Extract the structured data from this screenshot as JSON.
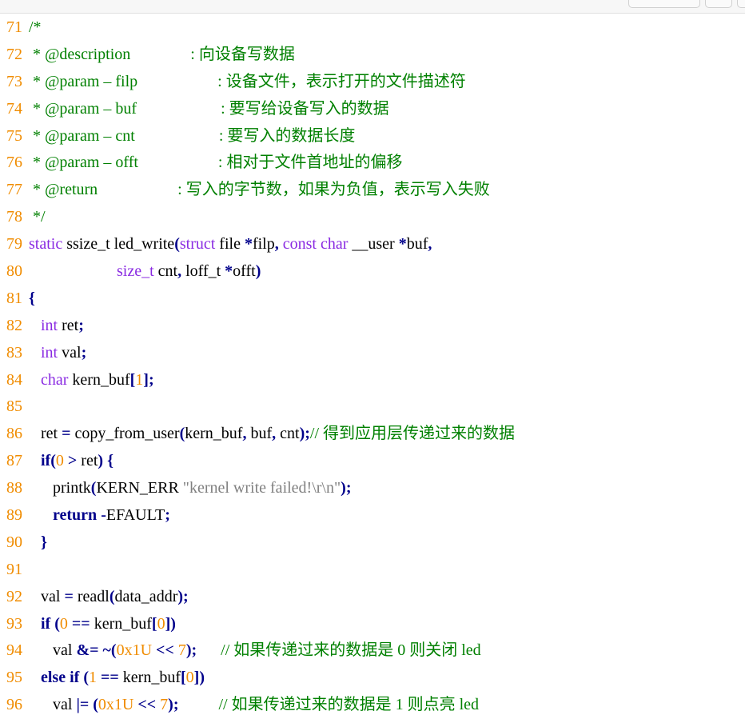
{
  "lines": [
    {
      "no": "71",
      "segs": [
        {
          "t": "/*",
          "c": "c"
        }
      ]
    },
    {
      "no": "72",
      "segs": [
        {
          "t": " * @description               ",
          "c": "c"
        },
        {
          "t": ": 向设备写数据",
          "c": "c"
        }
      ]
    },
    {
      "no": "73",
      "segs": [
        {
          "t": " * @param – filp                    ",
          "c": "c"
        },
        {
          "t": ": 设备文件，表示打开的文件描述符",
          "c": "c"
        }
      ]
    },
    {
      "no": "74",
      "segs": [
        {
          "t": " * @param – buf                     ",
          "c": "c"
        },
        {
          "t": ": 要写给设备写入的数据",
          "c": "c"
        }
      ]
    },
    {
      "no": "75",
      "segs": [
        {
          "t": " * @param – cnt                     ",
          "c": "c"
        },
        {
          "t": ": 要写入的数据长度",
          "c": "c"
        }
      ]
    },
    {
      "no": "76",
      "segs": [
        {
          "t": " * @param – offt                    ",
          "c": "c"
        },
        {
          "t": ": 相对于文件首地址的偏移",
          "c": "c"
        }
      ]
    },
    {
      "no": "77",
      "segs": [
        {
          "t": " * @return                    ",
          "c": "c"
        },
        {
          "t": ": 写入的字节数，如果为负值，表示写入失败",
          "c": "c"
        }
      ]
    },
    {
      "no": "78",
      "segs": [
        {
          "t": " */",
          "c": "c"
        }
      ]
    },
    {
      "no": "79",
      "segs": [
        {
          "t": "static",
          "c": "k"
        },
        {
          "t": " ssize_t led_write",
          "c": ""
        },
        {
          "t": "(",
          "c": "p"
        },
        {
          "t": "struct",
          "c": "k"
        },
        {
          "t": " file ",
          "c": ""
        },
        {
          "t": "*",
          "c": "p"
        },
        {
          "t": "filp",
          "c": ""
        },
        {
          "t": ",",
          "c": "p"
        },
        {
          "t": " const",
          "c": "k"
        },
        {
          "t": " ",
          "c": ""
        },
        {
          "t": "char",
          "c": "k"
        },
        {
          "t": " __user ",
          "c": ""
        },
        {
          "t": "*",
          "c": "p"
        },
        {
          "t": "buf",
          "c": ""
        },
        {
          "t": ",",
          "c": "p"
        }
      ]
    },
    {
      "no": "80",
      "segs": [
        {
          "t": "                      ",
          "c": ""
        },
        {
          "t": "size_t",
          "c": "k"
        },
        {
          "t": " cnt",
          "c": ""
        },
        {
          "t": ",",
          "c": "p"
        },
        {
          "t": " loff_t ",
          "c": ""
        },
        {
          "t": "*",
          "c": "p"
        },
        {
          "t": "offt",
          "c": ""
        },
        {
          "t": ")",
          "c": "p"
        }
      ]
    },
    {
      "no": "81",
      "segs": [
        {
          "t": "{",
          "c": "p"
        }
      ]
    },
    {
      "no": "82",
      "segs": [
        {
          "t": "   ",
          "c": ""
        },
        {
          "t": "int",
          "c": "k"
        },
        {
          "t": " ret",
          "c": ""
        },
        {
          "t": ";",
          "c": "p"
        }
      ]
    },
    {
      "no": "83",
      "segs": [
        {
          "t": "   ",
          "c": ""
        },
        {
          "t": "int",
          "c": "k"
        },
        {
          "t": " val",
          "c": ""
        },
        {
          "t": ";",
          "c": "p"
        }
      ]
    },
    {
      "no": "84",
      "segs": [
        {
          "t": "   ",
          "c": ""
        },
        {
          "t": "char",
          "c": "k"
        },
        {
          "t": " kern_buf",
          "c": ""
        },
        {
          "t": "[",
          "c": "p"
        },
        {
          "t": "1",
          "c": "n"
        },
        {
          "t": "];",
          "c": "p"
        }
      ]
    },
    {
      "no": "85",
      "segs": []
    },
    {
      "no": "86",
      "segs": [
        {
          "t": "   ret ",
          "c": ""
        },
        {
          "t": "=",
          "c": "p"
        },
        {
          "t": " copy_from_user",
          "c": ""
        },
        {
          "t": "(",
          "c": "p"
        },
        {
          "t": "kern_buf",
          "c": ""
        },
        {
          "t": ",",
          "c": "p"
        },
        {
          "t": " buf",
          "c": ""
        },
        {
          "t": ",",
          "c": "p"
        },
        {
          "t": " cnt",
          "c": ""
        },
        {
          "t": ");",
          "c": "p"
        },
        {
          "t": "// 得到应用层传递过来的数据",
          "c": "c"
        }
      ]
    },
    {
      "no": "87",
      "segs": [
        {
          "t": "   ",
          "c": ""
        },
        {
          "t": "if",
          "c": "kb"
        },
        {
          "t": "(",
          "c": "p"
        },
        {
          "t": "0",
          "c": "n"
        },
        {
          "t": " > ",
          "c": "p"
        },
        {
          "t": "ret",
          "c": ""
        },
        {
          "t": ")",
          "c": "p"
        },
        {
          "t": " {",
          "c": "p"
        }
      ]
    },
    {
      "no": "88",
      "segs": [
        {
          "t": "      printk",
          "c": ""
        },
        {
          "t": "(",
          "c": "p"
        },
        {
          "t": "KERN_ERR ",
          "c": ""
        },
        {
          "t": "\"kernel write failed!\\r\\n\"",
          "c": "s"
        },
        {
          "t": ");",
          "c": "p"
        }
      ]
    },
    {
      "no": "89",
      "segs": [
        {
          "t": "      ",
          "c": ""
        },
        {
          "t": "return",
          "c": "kb"
        },
        {
          "t": " -",
          "c": "p"
        },
        {
          "t": "EFAULT",
          "c": ""
        },
        {
          "t": ";",
          "c": "p"
        }
      ]
    },
    {
      "no": "90",
      "segs": [
        {
          "t": "   ",
          "c": ""
        },
        {
          "t": "}",
          "c": "p"
        }
      ]
    },
    {
      "no": "91",
      "segs": []
    },
    {
      "no": "92",
      "segs": [
        {
          "t": "   val ",
          "c": ""
        },
        {
          "t": "=",
          "c": "p"
        },
        {
          "t": " readl",
          "c": ""
        },
        {
          "t": "(",
          "c": "p"
        },
        {
          "t": "data_addr",
          "c": ""
        },
        {
          "t": ");",
          "c": "p"
        }
      ]
    },
    {
      "no": "93",
      "segs": [
        {
          "t": "   ",
          "c": ""
        },
        {
          "t": "if",
          "c": "kb"
        },
        {
          "t": " (",
          "c": "p"
        },
        {
          "t": "0",
          "c": "n"
        },
        {
          "t": " == ",
          "c": "p"
        },
        {
          "t": "kern_buf",
          "c": ""
        },
        {
          "t": "[",
          "c": "p"
        },
        {
          "t": "0",
          "c": "n"
        },
        {
          "t": "])",
          "c": "p"
        }
      ]
    },
    {
      "no": "94",
      "segs": [
        {
          "t": "      val ",
          "c": ""
        },
        {
          "t": "&=",
          "c": "p"
        },
        {
          "t": " ",
          "c": ""
        },
        {
          "t": "~(",
          "c": "p"
        },
        {
          "t": "0x1U",
          "c": "n"
        },
        {
          "t": " << ",
          "c": "p"
        },
        {
          "t": "7",
          "c": "n"
        },
        {
          "t": ");",
          "c": "p"
        },
        {
          "t": "      ",
          "c": ""
        },
        {
          "t": "// 如果传递过来的数据是 0 则关闭 led",
          "c": "c"
        }
      ]
    },
    {
      "no": "95",
      "segs": [
        {
          "t": "   ",
          "c": ""
        },
        {
          "t": "else",
          "c": "kb"
        },
        {
          "t": " ",
          "c": ""
        },
        {
          "t": "if",
          "c": "kb"
        },
        {
          "t": " (",
          "c": "p"
        },
        {
          "t": "1",
          "c": "n"
        },
        {
          "t": " == ",
          "c": "p"
        },
        {
          "t": "kern_buf",
          "c": ""
        },
        {
          "t": "[",
          "c": "p"
        },
        {
          "t": "0",
          "c": "n"
        },
        {
          "t": "])",
          "c": "p"
        }
      ]
    },
    {
      "no": "96",
      "segs": [
        {
          "t": "      val ",
          "c": ""
        },
        {
          "t": "|=",
          "c": "p"
        },
        {
          "t": " (",
          "c": "p"
        },
        {
          "t": "0x1U",
          "c": "n"
        },
        {
          "t": " << ",
          "c": "p"
        },
        {
          "t": "7",
          "c": "n"
        },
        {
          "t": ");",
          "c": "p"
        },
        {
          "t": "          ",
          "c": ""
        },
        {
          "t": "// 如果传递过来的数据是 1 则点亮 led",
          "c": "c"
        }
      ]
    }
  ]
}
